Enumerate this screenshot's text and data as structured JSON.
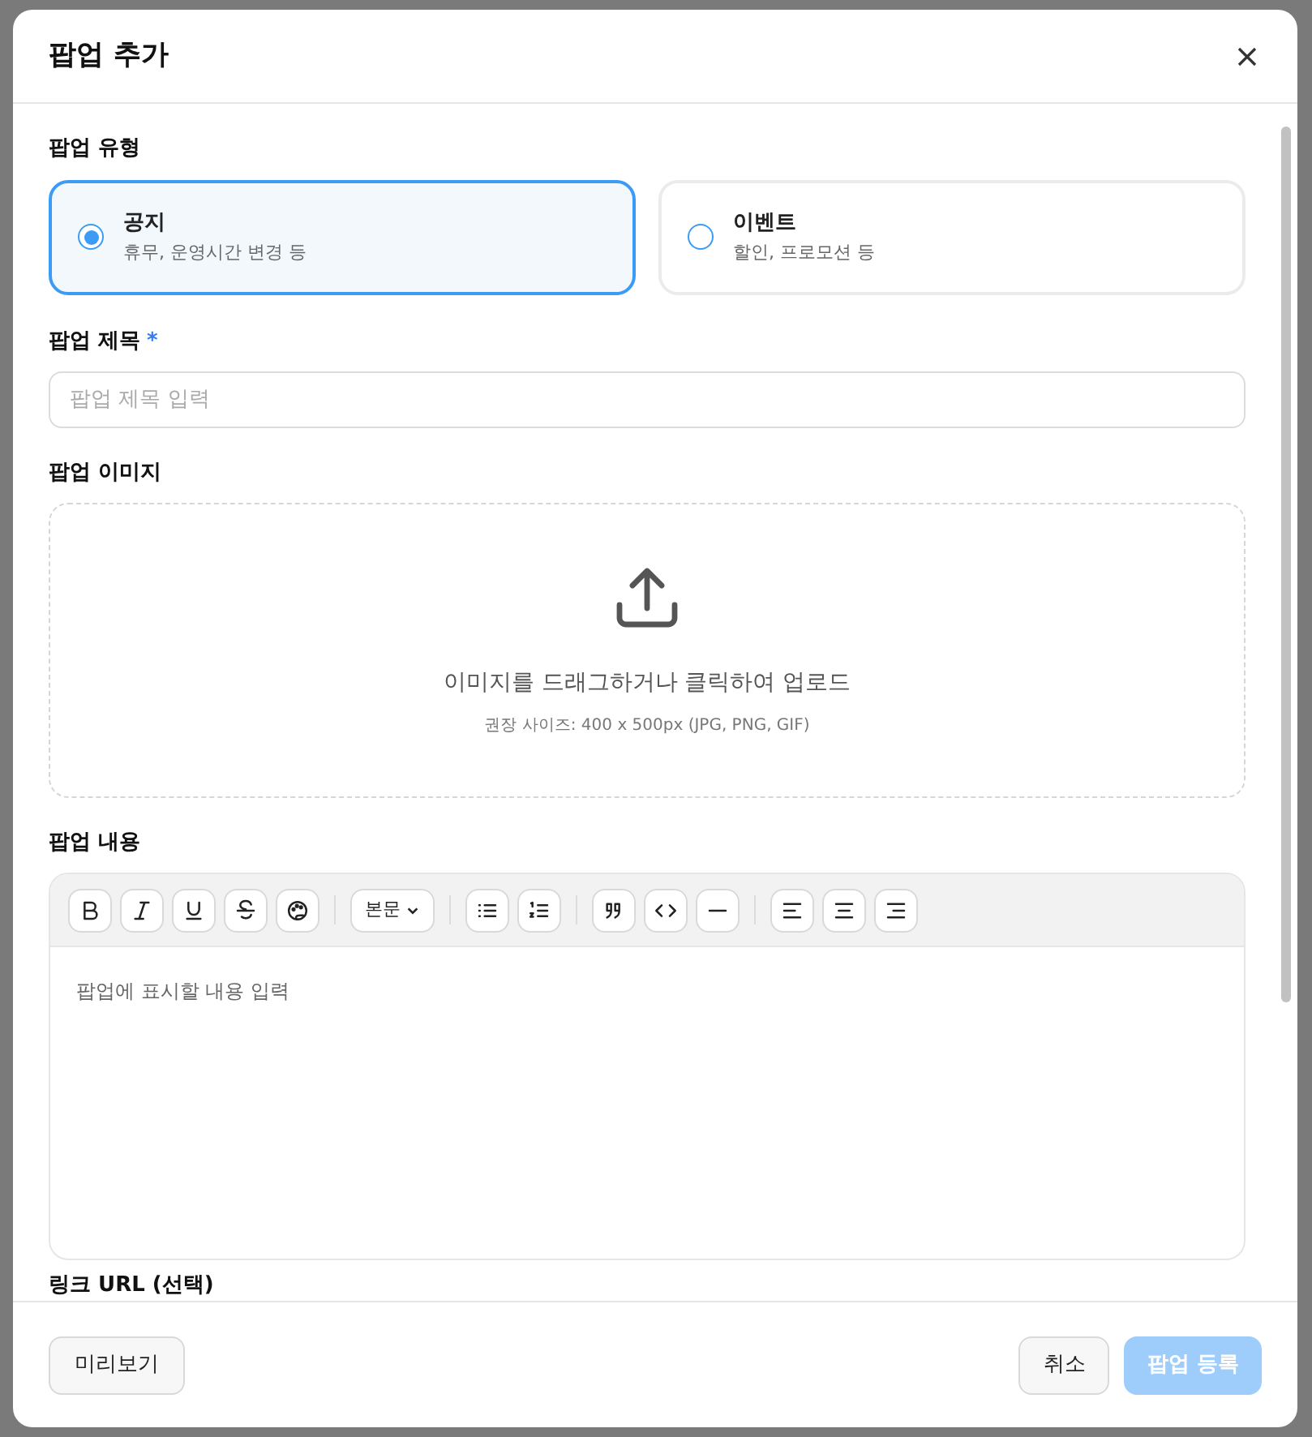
{
  "dialog": {
    "title": "팝업 추가"
  },
  "type_field": {
    "label": "팝업 유형",
    "options": [
      {
        "title": "공지",
        "description": "휴무, 운영시간 변경 등",
        "selected": true
      },
      {
        "title": "이벤트",
        "description": "할인, 프로모션 등",
        "selected": false
      }
    ]
  },
  "title_field": {
    "label": "팝업 제목",
    "required_mark": "*",
    "placeholder": "팝업 제목 입력"
  },
  "image_field": {
    "label": "팝업 이미지",
    "prompt": "이미지를 드래그하거나 클릭하여 업로드",
    "hint": "권장 사이즈: 400 x 500px (JPG, PNG, GIF)"
  },
  "content_field": {
    "label": "팝업 내용",
    "placeholder": "팝업에 표시할 내용 입력",
    "toolbar": [
      [
        {
          "kind": "bold"
        },
        {
          "kind": "italic"
        },
        {
          "kind": "underline"
        },
        {
          "kind": "strike"
        },
        {
          "kind": "palette"
        }
      ],
      [
        {
          "kind": "select",
          "label": "본문"
        }
      ],
      [
        {
          "kind": "bullet-list"
        },
        {
          "kind": "ordered-list"
        }
      ],
      [
        {
          "kind": "quote"
        },
        {
          "kind": "code"
        },
        {
          "kind": "rule"
        }
      ],
      [
        {
          "kind": "align-left"
        },
        {
          "kind": "align-center"
        },
        {
          "kind": "align-right"
        }
      ]
    ]
  },
  "link_field": {
    "label": "링크 URL (선택)"
  },
  "footer": {
    "preview": "미리보기",
    "cancel": "취소",
    "submit": "팝업 등록",
    "submit_disabled": true
  }
}
